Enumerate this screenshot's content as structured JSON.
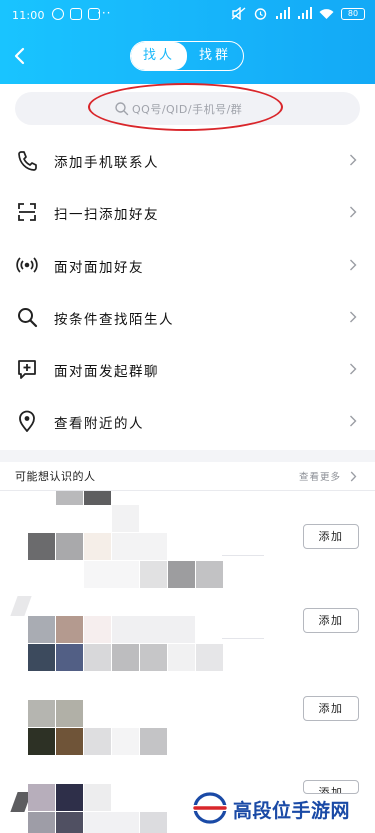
{
  "status_bar": {
    "time": "11:00",
    "dots": "···",
    "battery": "80"
  },
  "header": {
    "tabs": [
      {
        "label": "找人",
        "active": true
      },
      {
        "label": "找群",
        "active": false
      }
    ],
    "accent_color": "#17b6fb"
  },
  "search": {
    "placeholder": "QQ号/QID/手机号/群"
  },
  "menu": [
    {
      "label": "添加手机联系人",
      "icon": "phone-icon"
    },
    {
      "label": "扫一扫添加好友",
      "icon": "scan-icon"
    },
    {
      "label": "面对面加好友",
      "icon": "signal-broadcast-icon"
    },
    {
      "label": "按条件查找陌生人",
      "icon": "search-icon"
    },
    {
      "label": "面对面发起群聊",
      "icon": "chat-add-icon"
    },
    {
      "label": "查看附近的人",
      "icon": "location-pin-icon"
    }
  ],
  "people_section": {
    "title": "可能想认识的人",
    "more_label": "查看更多",
    "add_label": "添加"
  },
  "watermark": {
    "text": "高段位手游网"
  }
}
